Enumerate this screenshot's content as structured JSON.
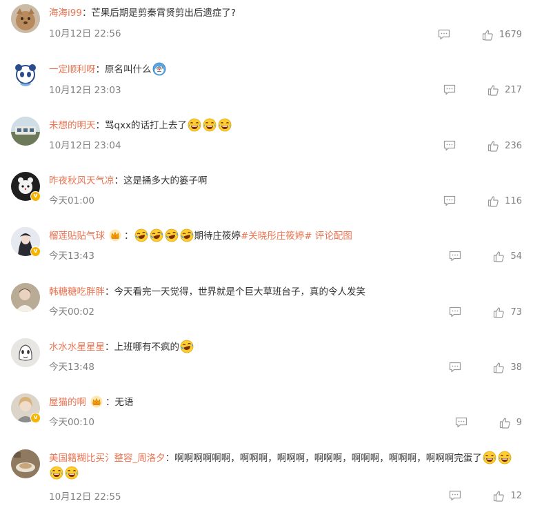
{
  "comments": [
    {
      "user": "海海i99",
      "sep": "：",
      "text": "芒果后期是剪秦霄贤剪出后遗症了?",
      "time": "10月12日 22:56",
      "likes": "1679",
      "verified": false,
      "crown": false,
      "emojis": []
    },
    {
      "user": "一定顺利呀",
      "sep": "：",
      "text": "原名叫什么",
      "time": "10月12日 23:03",
      "likes": "217",
      "verified": false,
      "crown": false,
      "emojis": [
        "confused-emoji"
      ]
    },
    {
      "user": "未想的明天",
      "sep": "：",
      "text": "骂qxx的话打上去了",
      "time": "10月12日 23:04",
      "likes": "236",
      "verified": false,
      "crown": false,
      "emojis": [
        "laugh-cry-emoji",
        "laugh-cry-emoji",
        "laugh-cry-emoji"
      ]
    },
    {
      "user": "昨夜秋风天气凉",
      "sep": "：",
      "text": "这是捅多大的篓子啊",
      "time": "今天01:00",
      "likes": "116",
      "verified": true,
      "crown": false,
      "emojis": []
    },
    {
      "user": "榴莲贴贴气球",
      "sep": "：",
      "text": "期待庄筱婷",
      "tag": "#关晓彤庄筱婷#",
      "link": "评论配图",
      "time": "今天13:43",
      "likes": "54",
      "verified": true,
      "crown": true,
      "emojis": [
        "tears-of-joy-emoji",
        "tears-of-joy-emoji",
        "tears-of-joy-emoji",
        "tears-of-joy-emoji"
      ]
    },
    {
      "user": "韩糖糖吃胖胖",
      "sep": "：",
      "text": "今天看完一天觉得，世界就是个巨大草班台子，真的令人发笑",
      "time": "今天00:02",
      "likes": "73",
      "verified": false,
      "crown": false,
      "emojis": []
    },
    {
      "user": "水水水星星星",
      "sep": "：",
      "text": "上班哪有不疯的",
      "time": "今天13:48",
      "likes": "38",
      "verified": false,
      "crown": false,
      "emojis": [
        "tears-of-joy-emoji"
      ]
    },
    {
      "user": "屋猫的啊",
      "sep": "：",
      "text": "无语",
      "time": "今天00:10",
      "likes": "9",
      "verified": true,
      "crown": true,
      "emojis": []
    },
    {
      "user": "美国籍糊比买氵整容_周洛夕",
      "sep": "：",
      "text": "啊啊啊啊啊啊，啊啊啊，啊啊啊，啊啊啊，啊啊啊，啊啊啊，啊啊啊完蛋了",
      "time": "10月12日 22:55",
      "likes": "12",
      "verified": false,
      "crown": false,
      "emojis": [
        "laugh-cry-emoji",
        "laugh-cry-emoji",
        "laugh-cry-emoji",
        "laugh-cry-emoji"
      ]
    }
  ],
  "colors": {
    "username": "#eb7350",
    "text": "#333333",
    "meta": "#808080",
    "verified_badge": "#f6b400"
  }
}
